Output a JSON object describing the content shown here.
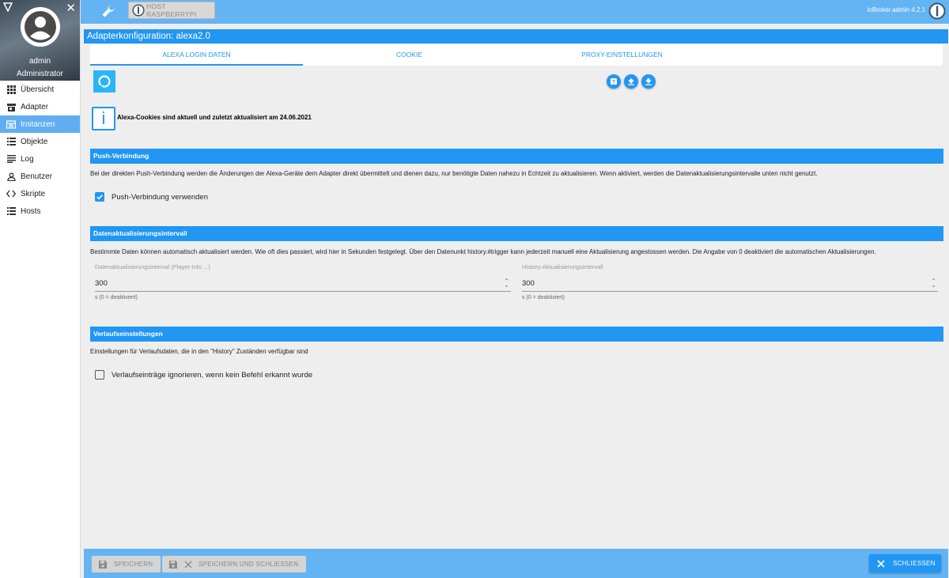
{
  "sidebar": {
    "username": "admin",
    "role": "Administrator",
    "items": [
      {
        "label": "Übersicht",
        "icon": "grid-icon"
      },
      {
        "label": "Adapter",
        "icon": "store-icon"
      },
      {
        "label": "Instanzen",
        "icon": "instances-icon",
        "active": true
      },
      {
        "label": "Objekte",
        "icon": "list-icon"
      },
      {
        "label": "Log",
        "icon": "log-icon"
      },
      {
        "label": "Benutzer",
        "icon": "user-icon"
      },
      {
        "label": "Skripte",
        "icon": "code-icon"
      },
      {
        "label": "Hosts",
        "icon": "hosts-icon"
      }
    ]
  },
  "topbar": {
    "host_label": "HOST RASPBERRYPI",
    "version": "ioBroker.admin 4.2.1"
  },
  "header": {
    "title": "Adapterkonfiguration: alexa2.0"
  },
  "tabs": [
    "ALEXA LOGIN DATEN",
    "COOKIE",
    "PROXY-EINSTELLUNGEN"
  ],
  "info": {
    "text": "Alexa-Cookies sind aktuell und zuletzt aktualisiert am 24.06.2021"
  },
  "push": {
    "title": "Push-Verbindung",
    "description": "Bei der direkten Push-Verbindung werden die Änderungen der Alexa-Geräte dem Adapter direkt übermittelt und dienen dazu, nur benötigte Daten nahezu in Echtzeit zu aktualisieren. Wenn aktiviert, werden die Datenaktualisierungsintervalle unten nicht genutzt.",
    "checkbox_label": "Push-Verbindung verwenden",
    "checked": true
  },
  "interval": {
    "title": "Datenaktualisierungsintervall",
    "description": "Bestimmte Daten können automatisch aktualisiert werden. Wie oft dies passiert, wird hier in Sekunden festgelegt. Über den Datenunkt history.#trigger kann jederzeit manuell eine Aktualisierung angestossen werden. Die Angabe von 0 deaktiviert die automatischen Aktualisierungen.",
    "field1": {
      "label": "Datenaktualisierungsinterval (Player-Info ...)",
      "value": "300",
      "help": "s (0 = deaktiviert)"
    },
    "field2": {
      "label": "History-Aktualisierungsintervall",
      "value": "300",
      "help": "s (0 = deaktiviert)"
    }
  },
  "history": {
    "title": "Verlaufseinstellungen",
    "description": "Einstellungen für Verlaufsdaten, die in den \"History\" Zuständen verfügbar sind",
    "checkbox_label": "Verlaufseinträge ignorieren, wenn kein Befehl erkannt wurde",
    "checked": false
  },
  "footer": {
    "save": "SPEICHERN",
    "save_close": "SPEICHERN UND SCHLIESSEN",
    "close": "SCHLIESSEN"
  },
  "colors": {
    "accent": "#2196f3",
    "bar": "#64b4f4",
    "background": "#eeeeee"
  }
}
